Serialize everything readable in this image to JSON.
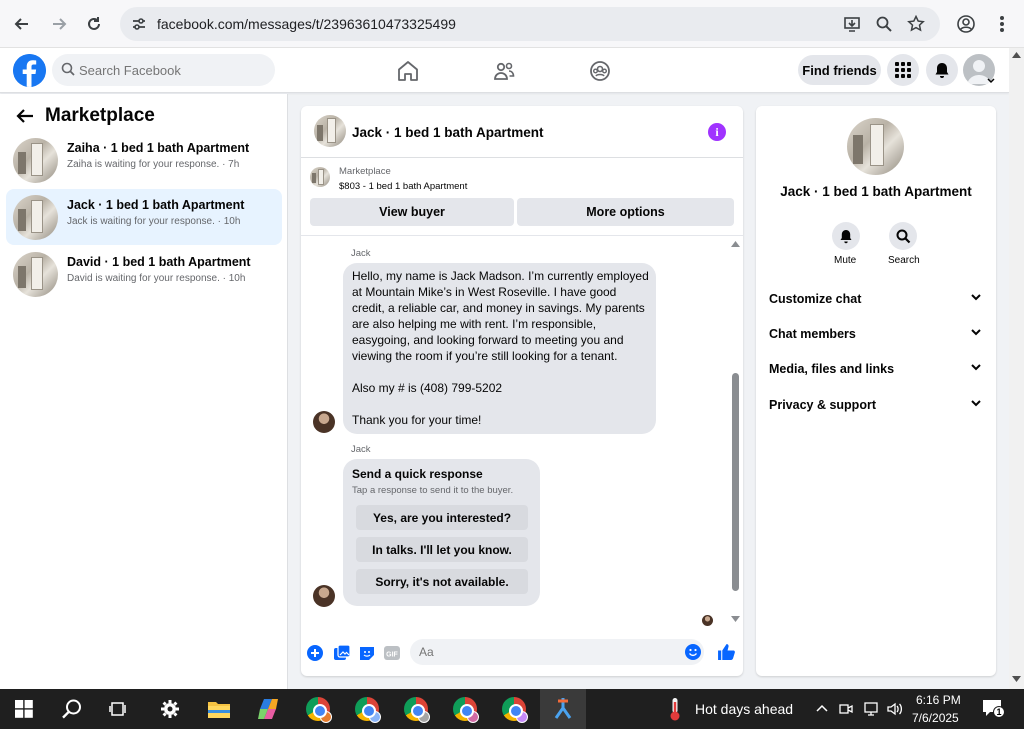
{
  "browser": {
    "url": "facebook.com/messages/t/23963610473325499"
  },
  "fb_header": {
    "search_placeholder": "Search Facebook",
    "find_friends": "Find friends",
    "accent": "#1877f2"
  },
  "left_panel": {
    "title": "Marketplace",
    "conversations": [
      {
        "title": "Zaiha · 1 bed 1 bath Apartment",
        "subtitle": "Zaiha is waiting for your response. · 7h"
      },
      {
        "title": "Jack · 1 bed 1 bath Apartment",
        "subtitle": "Jack is waiting for your response. · 10h"
      },
      {
        "title": "David · 1 bed 1 bath Apartment",
        "subtitle": "David is waiting for your response. · 10h"
      }
    ]
  },
  "chat": {
    "title": "Jack · 1 bed 1 bath Apartment",
    "marketplace_label": "Marketplace",
    "listing": "$803 - 1 bed 1 bath Apartment",
    "view_buyer": "View buyer",
    "more_options": "More options",
    "sender": "Jack",
    "message_lines": [
      "Hello, my name is Jack Madson. I’m currently employed",
      "at Mountain Mike’s in West Roseville. I have good",
      "credit, a reliable car, and money in savings. My parents",
      "are also helping me with rent. I’m responsible,",
      "easygoing, and looking forward to meeting you and",
      "viewing the room if you’re still looking for a tenant.",
      "",
      "Also my # is (408) 799-5202",
      "",
      "Thank you for your time!"
    ],
    "quick": {
      "title": "Send a quick response",
      "subtitle": "Tap a response to send it to the buyer.",
      "options": [
        "Yes, are you interested?",
        "In talks. I'll let you know.",
        "Sorry, it's not available."
      ]
    },
    "composer_placeholder": "Aa"
  },
  "info_panel": {
    "name": "Jack · 1 bed 1 bath Apartment",
    "mute": "Mute",
    "search": "Search",
    "sections": [
      "Customize chat",
      "Chat members",
      "Media, files and links",
      "Privacy & support"
    ]
  },
  "taskbar": {
    "weather": "Hot days ahead",
    "time": "6:16 PM",
    "date": "7/6/2025",
    "notifications": "1"
  }
}
